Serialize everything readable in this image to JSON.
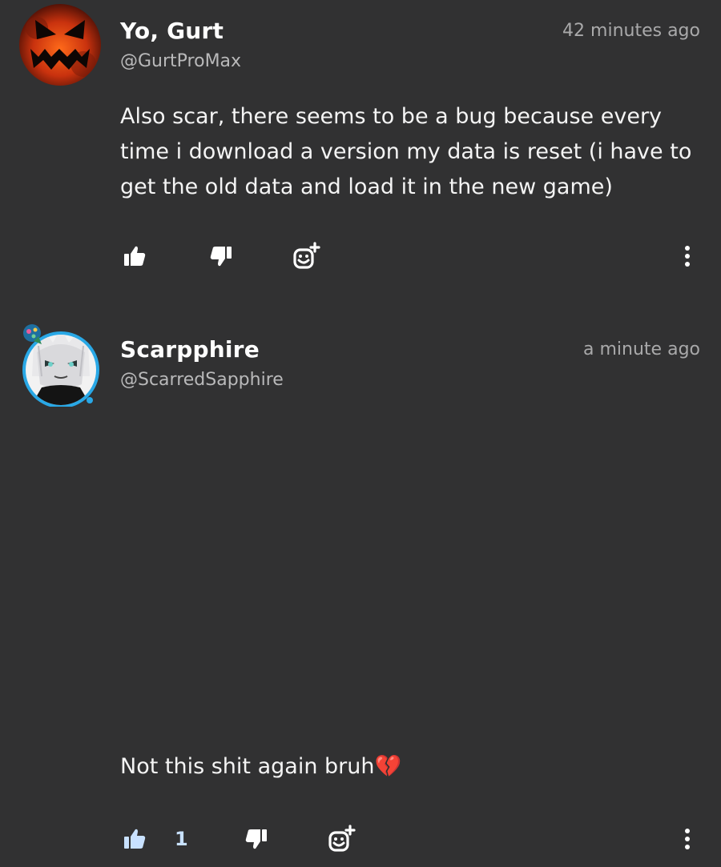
{
  "comments": [
    {
      "display_name": "Yo, Gurt",
      "handle": "@GurtProMax",
      "time": "42 minutes ago",
      "text": "Also scar, there seems to be a bug because every time i download a version my data is reset (i have to get the old data and load it in the new game)",
      "like_count": "",
      "liked": false,
      "avatar_icon": "jack-o-lantern-icon"
    },
    {
      "display_name": "Scarpphire",
      "handle": "@ScarredSapphire",
      "time": "a minute ago",
      "text": "Not this shit again bruh",
      "emoji": "💔",
      "like_count": "1",
      "liked": true,
      "avatar_icon": "anime-character-icon"
    }
  ],
  "colors": {
    "background": "#313132",
    "text": "#ffffff",
    "secondary_text": "#b9b9ba",
    "liked_accent": "#c8e1ff",
    "broken_heart": "#e03a4b",
    "avatar_ring": "#29a8e6"
  },
  "icons": {
    "like": "thumbs-up-icon",
    "dislike": "thumbs-down-icon",
    "react": "add-reaction-icon",
    "more": "more-vertical-icon"
  }
}
